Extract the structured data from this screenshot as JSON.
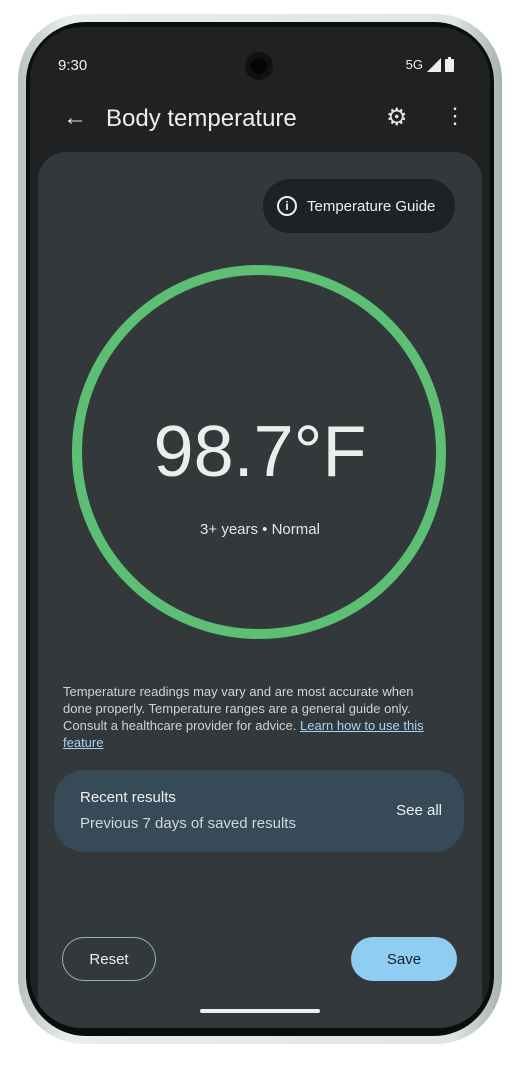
{
  "status_bar": {
    "time": "9:30",
    "network": "5G"
  },
  "app_bar": {
    "title": "Body temperature",
    "back_icon": "arrow-back-icon",
    "settings_icon": "gear-icon",
    "more_icon": "more-vert-icon"
  },
  "guide_button": {
    "label": "Temperature Guide",
    "icon": "info-icon"
  },
  "reading": {
    "value": "98.7°F",
    "detail": "3+ years • Normal",
    "status_color": "#5dbf73"
  },
  "disclaimer": {
    "text": "Temperature readings may vary and are most accurate when done properly. Temperature ranges are a general guide only. Consult a healthcare provider for advice. ",
    "link": "Learn how to use this feature"
  },
  "recent": {
    "title": "Recent results",
    "subtitle": "Previous 7 days of saved results",
    "see_all": "See all"
  },
  "actions": {
    "reset": "Reset",
    "save": "Save"
  },
  "colors": {
    "accent": "#8fcdf2",
    "ring": "#5dbf73"
  }
}
